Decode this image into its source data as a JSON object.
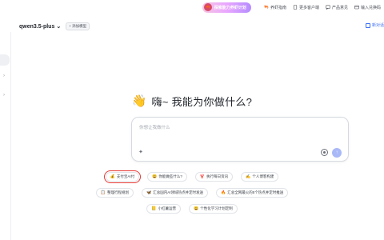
{
  "topbar": {
    "promo_label": "探索能力养虾计划",
    "links": [
      {
        "label": "养虾指南",
        "icon": "shrimp-icon"
      },
      {
        "label": "更多客户端",
        "icon": "phone-icon"
      },
      {
        "label": "产品意见",
        "icon": "feedback-icon"
      },
      {
        "label": "输入兑换码",
        "icon": "code-icon"
      }
    ]
  },
  "model": {
    "name": "qwen3.5-plus",
    "add_model_label": "+ 添加模型"
  },
  "new_chat_label": "新对话",
  "hero": {
    "wave_icon": "waving-hand-icon",
    "greeting": "嗨~ 我能为你做什么?"
  },
  "input": {
    "placeholder": "你想让我做什么"
  },
  "chips": [
    {
      "label": "支付宝AI付",
      "icon": "💰",
      "active": true
    },
    {
      "label": "你能做些什么?",
      "icon": "😀"
    },
    {
      "label": "执行每日资讯",
      "icon": "🦞"
    },
    {
      "label": "个人博客构建",
      "icon": "✍"
    },
    {
      "label": "整理行程规划",
      "icon": "📋"
    },
    {
      "label": "汇总国内AI领域热点并定时发送",
      "icon": "🦋"
    },
    {
      "label": "汇总全网最火的5个热点并定时推送",
      "icon": "🔥"
    },
    {
      "label": "小红薯运营",
      "icon": "📒"
    },
    {
      "label": "个性化学习计划定制",
      "icon": "😀"
    }
  ]
}
